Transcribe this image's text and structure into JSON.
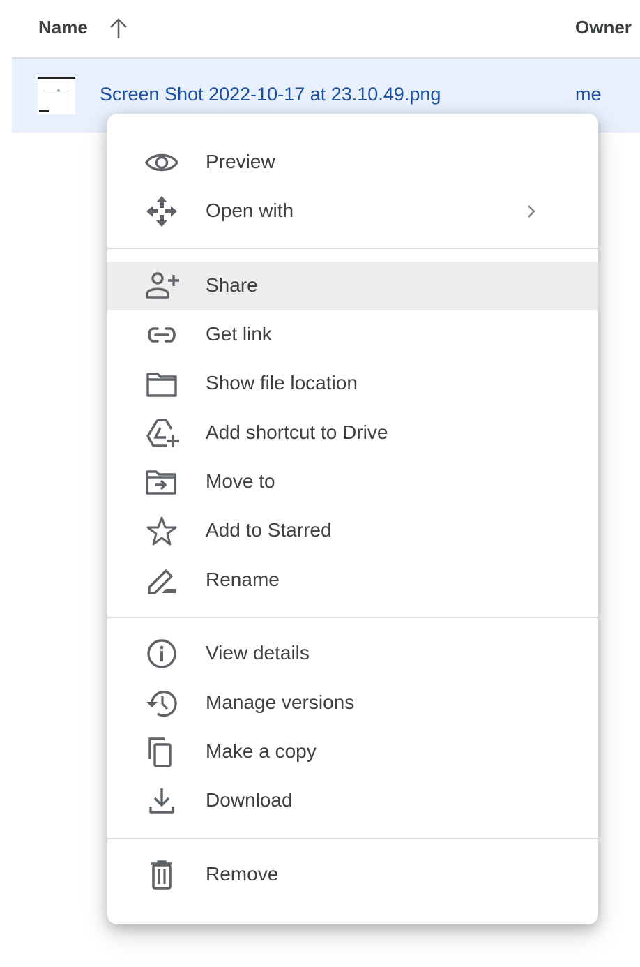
{
  "header": {
    "name_label": "Name",
    "sort_icon": "arrow-up-icon",
    "owner_label": "Owner"
  },
  "file_row": {
    "name": "Screen Shot 2022-10-17 at 23.10.49.png",
    "owner": "me",
    "selected": true
  },
  "context_menu": {
    "groups": [
      [
        {
          "label": "Preview",
          "icon": "eye-icon"
        },
        {
          "label": "Open with",
          "icon": "move-arrows-icon",
          "submenu": true
        }
      ],
      [
        {
          "label": "Share",
          "icon": "person-add-icon",
          "highlighted": true
        },
        {
          "label": "Get link",
          "icon": "link-icon"
        },
        {
          "label": "Show file location",
          "icon": "folder-icon"
        },
        {
          "label": "Add shortcut to Drive",
          "icon": "drive-shortcut-icon"
        },
        {
          "label": "Move to",
          "icon": "folder-move-icon"
        },
        {
          "label": "Add to Starred",
          "icon": "star-icon"
        },
        {
          "label": "Rename",
          "icon": "pencil-icon"
        }
      ],
      [
        {
          "label": "View details",
          "icon": "info-icon"
        },
        {
          "label": "Manage versions",
          "icon": "history-icon"
        },
        {
          "label": "Make a copy",
          "icon": "copy-icon"
        },
        {
          "label": "Download",
          "icon": "download-icon"
        }
      ],
      [
        {
          "label": "Remove",
          "icon": "trash-icon"
        }
      ]
    ]
  },
  "colors": {
    "selection_bg": "#e8f0fe",
    "link_blue": "#1a4fa0",
    "icon_gray": "#5f6368",
    "hover_bg": "#eeeeee"
  }
}
